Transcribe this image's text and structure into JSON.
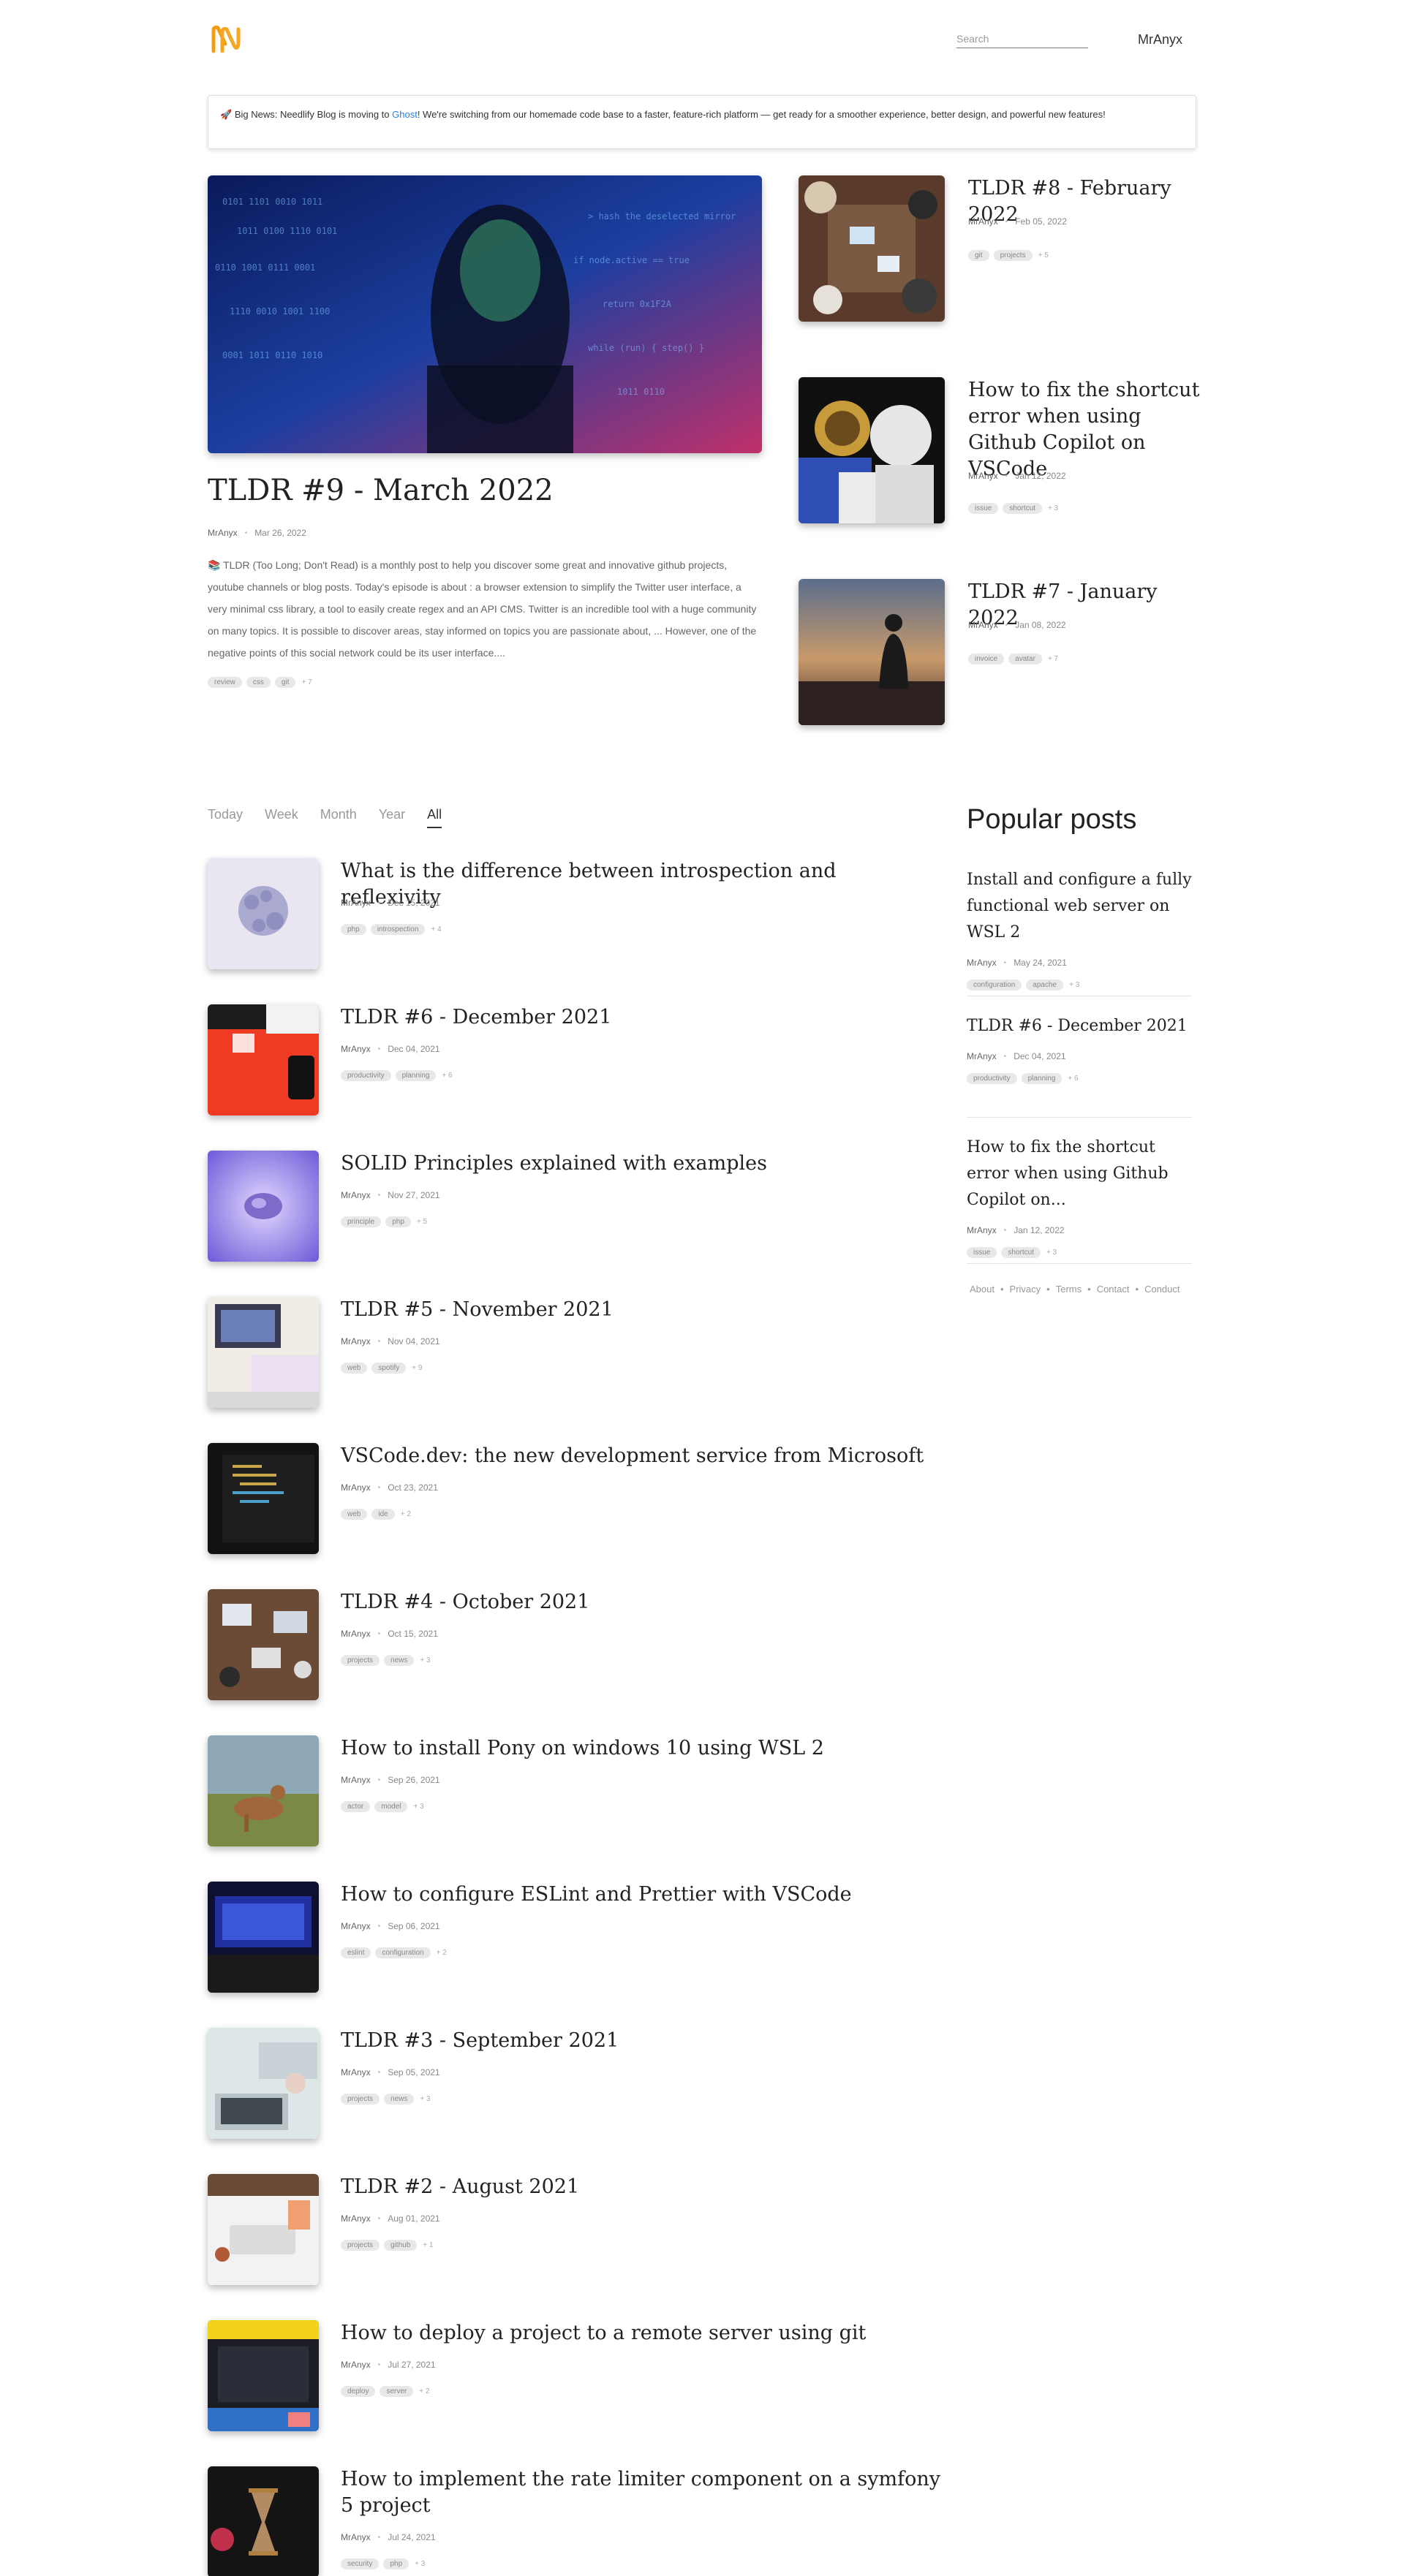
{
  "header": {
    "search_placeholder": "Search",
    "user": "MrAnyx"
  },
  "announcement": {
    "emoji": "🚀",
    "before": "Big News: Needlify Blog is moving to ",
    "link": "Ghost",
    "after": "! We're switching from our homemade code base to a faster, feature-rich platform — get ready for a smoother experience, better design, and powerful new features!"
  },
  "featured": {
    "title": "TLDR #9 - March 2022",
    "author": "MrAnyx",
    "date": "Mar 26, 2022",
    "excerpt": "📚 TLDR (Too Long; Don't Read) is a monthly post to help you discover some great and innovative github projects, youtube channels or blog posts. Today's episode is about : a browser extension to simplify the Twitter user interface, a very minimal css library, a tool to easily create regex and an API CMS. Twitter is an incredible tool with a huge community on many topics. It is possible to discover areas, stay informed on topics you are passionate about, ... However, one of the negative points of this social network could be its user interface....",
    "tags": [
      "review",
      "css",
      "git"
    ],
    "more": "+ 7"
  },
  "side_posts": [
    {
      "title": "TLDR #8 - February 2022",
      "author": "MrAnyx",
      "date": "Feb 05, 2022",
      "tags": [
        "git",
        "projects"
      ],
      "more": "+ 5"
    },
    {
      "title": "How to fix the shortcut error when using Github Copilot on VSCode",
      "author": "MrAnyx",
      "date": "Jan 12, 2022",
      "tags": [
        "issue",
        "shortcut"
      ],
      "more": "+ 3"
    },
    {
      "title": "TLDR #7 - January 2022",
      "author": "MrAnyx",
      "date": "Jan 08, 2022",
      "tags": [
        "invoice",
        "avatar"
      ],
      "more": "+ 7"
    }
  ],
  "filters": [
    "Today",
    "Week",
    "Month",
    "Year",
    "All"
  ],
  "posts": [
    {
      "title": "What is the difference between introspection and reflexivity",
      "author": "MrAnyx",
      "date": "Dec 15, 2021",
      "tags": [
        "php",
        "introspection"
      ],
      "more": "+ 4"
    },
    {
      "title": "TLDR #6 - December 2021",
      "author": "MrAnyx",
      "date": "Dec 04, 2021",
      "tags": [
        "productivity",
        "planning"
      ],
      "more": "+ 6"
    },
    {
      "title": "SOLID Principles explained with examples",
      "author": "MrAnyx",
      "date": "Nov 27, 2021",
      "tags": [
        "principle",
        "php"
      ],
      "more": "+ 5"
    },
    {
      "title": "TLDR #5 - November 2021",
      "author": "MrAnyx",
      "date": "Nov 04, 2021",
      "tags": [
        "web",
        "spotify"
      ],
      "more": "+ 9"
    },
    {
      "title": "VSCode.dev: the new development service from Microsoft",
      "author": "MrAnyx",
      "date": "Oct 23, 2021",
      "tags": [
        "web",
        "ide"
      ],
      "more": "+ 2"
    },
    {
      "title": "TLDR #4 - October 2021",
      "author": "MrAnyx",
      "date": "Oct 15, 2021",
      "tags": [
        "projects",
        "news"
      ],
      "more": "+ 3"
    },
    {
      "title": "How to install Pony on windows 10 using WSL 2",
      "author": "MrAnyx",
      "date": "Sep 26, 2021",
      "tags": [
        "actor",
        "model"
      ],
      "more": "+ 3"
    },
    {
      "title": "How to configure ESLint and Prettier with VSCode",
      "author": "MrAnyx",
      "date": "Sep 06, 2021",
      "tags": [
        "eslint",
        "configuration"
      ],
      "more": "+ 2"
    },
    {
      "title": "TLDR #3 - September 2021",
      "author": "MrAnyx",
      "date": "Sep 05, 2021",
      "tags": [
        "projects",
        "news"
      ],
      "more": "+ 3"
    },
    {
      "title": "TLDR #2 - August 2021",
      "author": "MrAnyx",
      "date": "Aug 01, 2021",
      "tags": [
        "projects",
        "github"
      ],
      "more": "+ 1"
    },
    {
      "title": "How to deploy a project to a remote server using git",
      "author": "MrAnyx",
      "date": "Jul 27, 2021",
      "tags": [
        "deploy",
        "server"
      ],
      "more": "+ 2"
    },
    {
      "title": "How to implement the rate limiter component on a symfony 5 project",
      "author": "MrAnyx",
      "date": "Jul 24, 2021",
      "tags": [
        "security",
        "php"
      ],
      "more": "+ 3"
    }
  ],
  "popular": {
    "heading": "Popular posts",
    "items": [
      {
        "title": "Install and configure a fully functional web server on WSL 2",
        "author": "MrAnyx",
        "date": "May 24, 2021",
        "tags": [
          "configuration",
          "apache"
        ],
        "more": "+ 3"
      },
      {
        "title": "TLDR #6 - December 2021",
        "author": "MrAnyx",
        "date": "Dec 04, 2021",
        "tags": [
          "productivity",
          "planning"
        ],
        "more": "+ 6"
      },
      {
        "title": "How to fix the shortcut error when using Github Copilot on...",
        "author": "MrAnyx",
        "date": "Jan 12, 2022",
        "tags": [
          "issue",
          "shortcut"
        ],
        "more": "+ 3"
      }
    ]
  },
  "footer": [
    "About",
    "Privacy",
    "Terms",
    "Contact",
    "Conduct"
  ],
  "footer_sep": "•",
  "meta_sep": "•",
  "colors": {
    "accent": "#f39c12",
    "link": "#2a7de1"
  }
}
